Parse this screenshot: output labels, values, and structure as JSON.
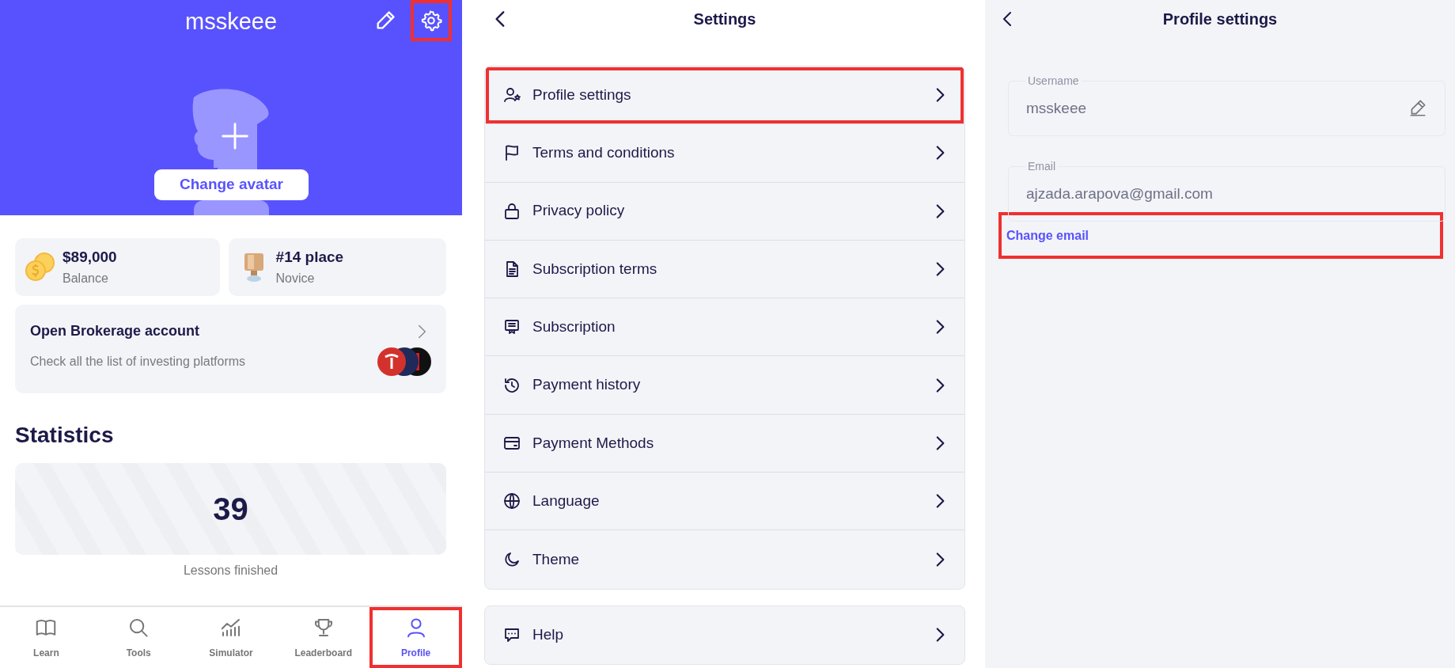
{
  "profile": {
    "username": "msskeee",
    "settings_highlighted": true,
    "avatar_button": "Change avatar",
    "stats": [
      {
        "kind": "coins",
        "value": "$89,000",
        "label": "Balance"
      },
      {
        "kind": "trophy",
        "value": "#14 place",
        "label": "Novice"
      }
    ],
    "brokerage": {
      "title": "Open Brokerage account",
      "subtitle": "Check all the list of investing platforms"
    },
    "statistics": {
      "heading": "Statistics",
      "value": "39",
      "label": "Lessons finished"
    }
  },
  "bottom_nav": [
    {
      "label": "Learn",
      "selected": false,
      "highlighted": false
    },
    {
      "label": "Tools",
      "selected": false,
      "highlighted": false
    },
    {
      "label": "Simulator",
      "selected": false,
      "highlighted": false
    },
    {
      "label": "Leaderboard",
      "selected": false,
      "highlighted": false
    },
    {
      "label": "Profile",
      "selected": true,
      "highlighted": true
    }
  ],
  "settings": {
    "title": "Settings",
    "items": [
      {
        "label": "Profile settings",
        "highlighted": true
      },
      {
        "label": "Terms and conditions",
        "highlighted": false
      },
      {
        "label": "Privacy policy",
        "highlighted": false
      },
      {
        "label": "Subscription terms",
        "highlighted": false
      },
      {
        "label": "Subscription",
        "highlighted": false
      },
      {
        "label": "Payment history",
        "highlighted": false
      },
      {
        "label": "Payment Methods",
        "highlighted": false
      },
      {
        "label": "Language",
        "highlighted": false
      },
      {
        "label": "Theme",
        "highlighted": false
      }
    ],
    "help": {
      "label": "Help"
    }
  },
  "profile_settings": {
    "title": "Profile settings",
    "fields": [
      {
        "label": "Username",
        "value": "msskeee",
        "editable": true
      },
      {
        "label": "Email",
        "value": "ajzada.arapova@gmail.com",
        "editable": false
      }
    ],
    "link": "Change email",
    "link_highlighted": true
  }
}
